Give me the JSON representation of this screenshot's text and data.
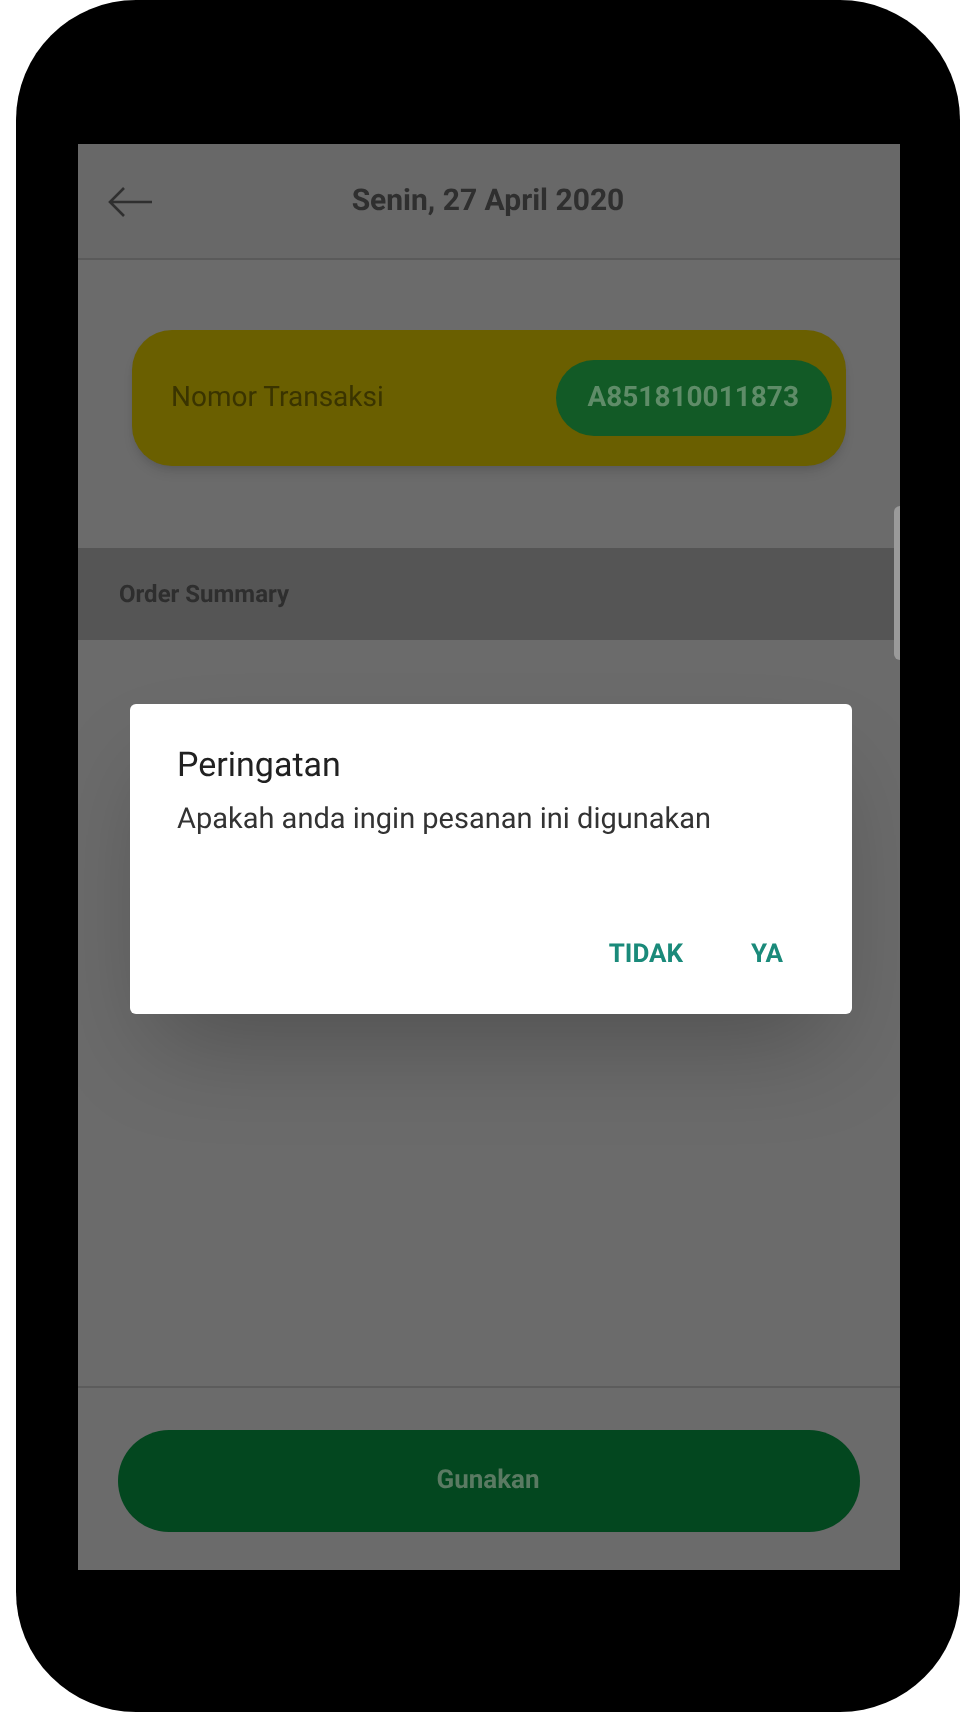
{
  "header": {
    "title": "Senin, 27 April 2020"
  },
  "transaction": {
    "label": "Nomor Transaksi",
    "number": "A851810011873"
  },
  "section": {
    "title": "Order Summary"
  },
  "dialog": {
    "title": "Peringatan",
    "message": "Apakah anda ingin pesanan ini digunakan",
    "buttons": [
      "TIDAK",
      "YA"
    ]
  },
  "primary_button": {
    "label": "Gunakan"
  }
}
